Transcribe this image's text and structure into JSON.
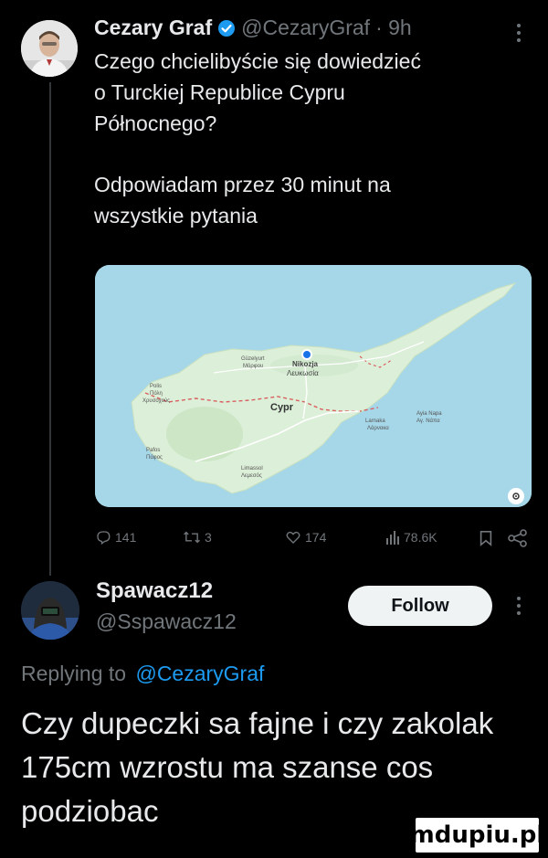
{
  "tweet": {
    "author_name": "Cezary Graf",
    "author_handle": "@CezaryGraf",
    "time": "· 9h",
    "text_line1": "Czego chcielibyście się dowiedzieć",
    "text_line2": "o Turckiej Republice Cypru",
    "text_line3": "Północnego?",
    "text_line4": "Odpowiadam przez 30 minut na",
    "text_line5": "wszystkie pytania",
    "map": {
      "labels": {
        "nikozja": "Nikozja",
        "lefkosia": "Λευκωσία",
        "guzelyurt": "Güzelyurt",
        "morfou": "Μόρφου",
        "polis": "Polis",
        "polis_gr": "Πόλη",
        "chrysochous": "Χρυσοχούς",
        "cypr": "Cypr",
        "larnaka": "Larnaka",
        "larnaca_gr": "Λάρνακα",
        "ayia_napa": "Ayia Napa",
        "ayia_napa_gr": "Αγ. Νάπα",
        "pafos": "Pafos",
        "pafos_gr": "Πάφος",
        "limassol": "Limassol",
        "lemesos": "Λεμεσός"
      },
      "colors": {
        "sea": "#a6d7e8",
        "land": "#dcefd8",
        "border": "#d96060"
      }
    },
    "actions": {
      "replies": "141",
      "retweets": "3",
      "likes": "174",
      "views": "78.6K"
    }
  },
  "reply": {
    "author_name": "Spawacz12",
    "author_handle": "@Sspawacz12",
    "follow_label": "Follow",
    "replying_prefix": "Replying to",
    "replying_handle": "@CezaryGraf",
    "text_line1": "Czy dupeczki sa fajne i czy zakolak",
    "text_line2": "175cm wzrostu ma szanse cos",
    "text_line3": "podziobac"
  },
  "watermark": {
    "text": "mdupiu.pl"
  },
  "colors": {
    "accent": "#1d9bf0",
    "muted": "#71767b",
    "text": "#e7e9ea",
    "background": "#000000"
  }
}
